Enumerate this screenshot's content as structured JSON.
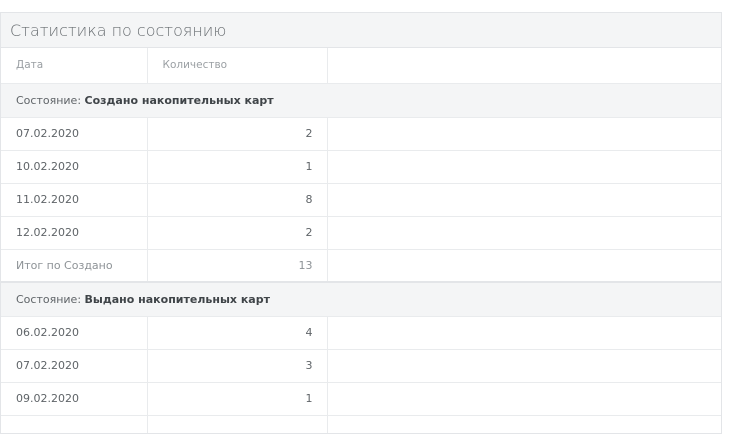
{
  "panel": {
    "title": "Статистика по состоянию"
  },
  "columns": {
    "date": "Дата",
    "count": "Количество"
  },
  "groups": [
    {
      "prefix": "Состояние: ",
      "name": "Создано накопительных карт",
      "rows": [
        {
          "date": "07.02.2020",
          "count": "2"
        },
        {
          "date": "10.02.2020",
          "count": "1"
        },
        {
          "date": "11.02.2020",
          "count": "8"
        },
        {
          "date": "12.02.2020",
          "count": "2"
        }
      ],
      "total_label": "Итог по Создано",
      "total_count": "13"
    },
    {
      "prefix": "Состояние: ",
      "name": "Выдано накопительных карт",
      "rows": [
        {
          "date": "06.02.2020",
          "count": "4"
        },
        {
          "date": "07.02.2020",
          "count": "3"
        },
        {
          "date": "09.02.2020",
          "count": "1"
        }
      ]
    }
  ]
}
